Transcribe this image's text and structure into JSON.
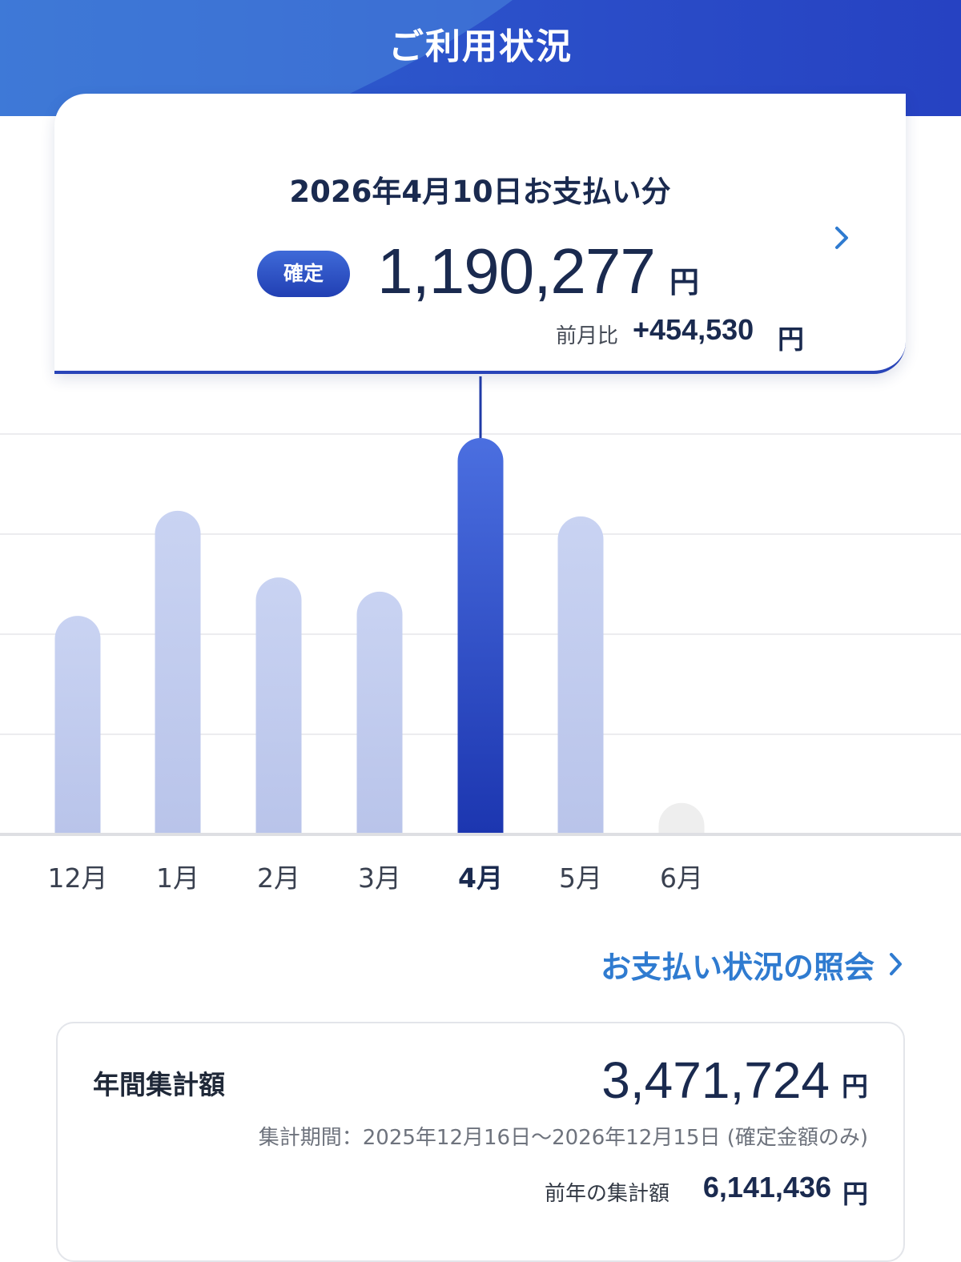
{
  "header": {
    "title": "ご利用状況"
  },
  "summary": {
    "date_label": "2026年4月10日お支払い分",
    "status": "確定",
    "amount": "1,190,277",
    "unit": "円",
    "diff_label": "前月比",
    "diff_value": "+454,530",
    "diff_unit": "円"
  },
  "chart_data": {
    "type": "bar",
    "categories": [
      "12月",
      "1月",
      "2月",
      "3月",
      "4月",
      "5月",
      "6月"
    ],
    "values": [
      654000,
      971000,
      770000,
      727000,
      1190277,
      954000,
      90000
    ],
    "selected_index": 4,
    "ylim": [
      0,
      1190277
    ],
    "grid": true,
    "colors": {
      "bar": "#c4cff0",
      "selected_top": "#4b6fe0",
      "selected_bottom": "#1c36b0",
      "empty": "#eeeeee"
    }
  },
  "link": {
    "label": "お支払い状況の照会"
  },
  "annual": {
    "label": "年間集計額",
    "amount": "3,471,724",
    "unit": "円",
    "period": "集計期間：2025年12月16日〜2026年12月15日 (確定金額のみ)",
    "prev_label": "前年の集計額",
    "prev_amount": "6,141,436",
    "prev_unit": "円"
  },
  "colors": {
    "accent": "#2844b8",
    "link": "#2f7bd0",
    "text": "#1a2a4f"
  }
}
